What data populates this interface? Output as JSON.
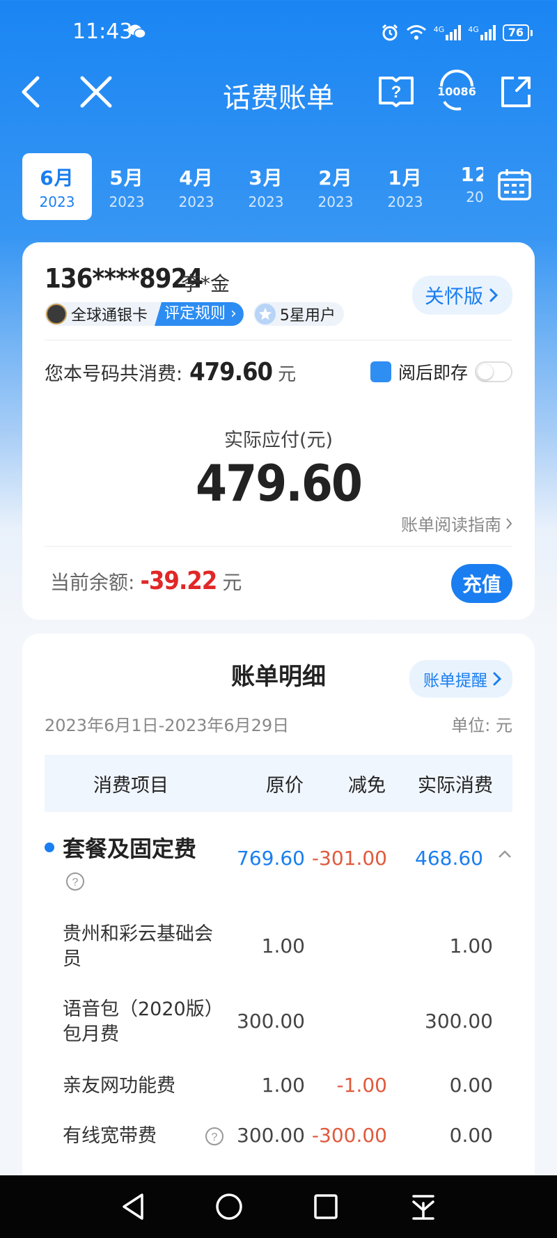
{
  "status_bar": {
    "time": "11:43",
    "network_1": "4G",
    "network_2": "4G",
    "battery": "76"
  },
  "nav": {
    "title": "话费账单",
    "service_number": "10086"
  },
  "months": [
    {
      "month": "6月",
      "year": "2023",
      "active": true
    },
    {
      "month": "5月",
      "year": "2023"
    },
    {
      "month": "4月",
      "year": "2023"
    },
    {
      "month": "3月",
      "year": "2023"
    },
    {
      "month": "2月",
      "year": "2023"
    },
    {
      "month": "1月",
      "year": "2023"
    },
    {
      "month": "12",
      "year": "20"
    }
  ],
  "account": {
    "phone": "136****8924",
    "owner": "李*金",
    "care_label": "关怀版",
    "card_level": "全球通银卡",
    "rating_rule": "评定规则",
    "star_level": "5星用户",
    "total_label": "您本号码共消费:",
    "total_amount": "479.60",
    "currency": "元",
    "save_label": "阅后即存",
    "due_label": "实际应付(元)",
    "due_amount": "479.60",
    "guide_label": "账单阅读指南",
    "balance_label": "当前余额:",
    "balance_amount": "-39.22",
    "balance_unit": "元",
    "recharge_label": "充值"
  },
  "detail": {
    "title": "账单明细",
    "remind_label": "账单提醒",
    "period": "2023年6月1日-2023年6月29日",
    "unit_label": "单位: 元",
    "columns": {
      "item": "消费项目",
      "orig": "原价",
      "disc": "减免",
      "actual": "实际消费"
    },
    "group": {
      "name": "套餐及固定费",
      "orig": "769.60",
      "disc": "-301.00",
      "actual": "468.60"
    },
    "items": [
      {
        "name": "贵州和彩云基础会员",
        "orig": "1.00",
        "disc": "",
        "actual": "1.00"
      },
      {
        "name": "语音包（2020版）包月费",
        "orig": "300.00",
        "disc": "",
        "actual": "300.00"
      },
      {
        "name": "亲友网功能费",
        "orig": "1.00",
        "disc": "-1.00",
        "actual": "0.00"
      },
      {
        "name": "有线宽带费",
        "orig": "300.00",
        "disc": "-300.00",
        "actual": "0.00"
      }
    ]
  },
  "colors": {
    "brand": "#1a7ef0",
    "negative": "#e12727",
    "discount": "#e05a3c"
  }
}
